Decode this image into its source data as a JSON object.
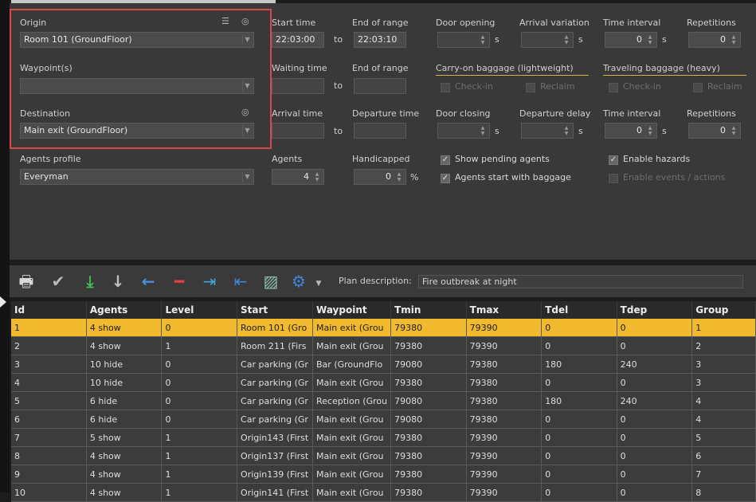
{
  "form": {
    "origin_label": "Origin",
    "origin_value": "Room 101 (GroundFloor)",
    "waypoints_label": "Waypoint(s)",
    "waypoints_value": "",
    "destination_label": "Destination",
    "destination_value": "Main exit (GroundFloor)",
    "agents_profile_label": "Agents profile",
    "agents_profile_value": "Everyman",
    "start_time_label": "Start time",
    "start_time_value": "22:03:00",
    "to": "to",
    "end_range_label": "End of range",
    "end_range_value": "22:03:10",
    "waiting_time_label": "Waiting time",
    "end_range2_label": "End of range",
    "arrival_time_label": "Arrival time",
    "departure_time_label": "Departure time",
    "agents_label": "Agents",
    "agents_value": "4",
    "handicapped_label": "Handicapped",
    "handicapped_value": "0",
    "percent": "%",
    "door_opening_label": "Door opening",
    "arrival_variation_label": "Arrival variation",
    "time_interval_label": "Time interval",
    "time_interval_value": "0",
    "repetitions_label": "Repetitions",
    "repetitions_value": "0",
    "carry_on_label": "Carry-on baggage (lightweight)",
    "traveling_label": "Traveling baggage (heavy)",
    "check_in": "Check-in",
    "reclaim": "Reclaim",
    "door_closing_label": "Door closing",
    "departure_delay_label": "Departure delay",
    "time_interval2_label": "Time interval",
    "time_interval2_value": "0",
    "repetitions2_label": "Repetitions",
    "repetitions2_value": "0",
    "unit_s": "s",
    "show_pending": "Show pending agents",
    "start_with_baggage": "Agents start with baggage",
    "enable_hazards": "Enable hazards",
    "enable_events": "Enable events / actions"
  },
  "toolbar": {
    "plan_description_label": "Plan description:",
    "plan_description_value": "Fire outbreak at night"
  },
  "table": {
    "columns": [
      "Id",
      "Agents",
      "Level",
      "Start",
      "Waypoint",
      "Tmin",
      "Tmax",
      "Tdel",
      "Tdep",
      "Group"
    ],
    "rows": [
      [
        "1",
        "4 show",
        "0",
        "Room 101 (Gro",
        "Main exit (Grou",
        "79380",
        "79390",
        "0",
        "0",
        "1"
      ],
      [
        "2",
        "4 show",
        "1",
        "Room 211 (Firs",
        "Main exit (Grou",
        "79380",
        "79390",
        "0",
        "0",
        "2"
      ],
      [
        "3",
        "10 hide",
        "0",
        "Car parking (Gr",
        "Bar (GroundFlo",
        "79080",
        "79380",
        "180",
        "240",
        "3"
      ],
      [
        "4",
        "10 hide",
        "0",
        "Car parking (Gr",
        "Main exit (Grou",
        "79380",
        "79380",
        "0",
        "0",
        "3"
      ],
      [
        "5",
        "6 hide",
        "0",
        "Car parking (Gr",
        "Reception (Grou",
        "79080",
        "79380",
        "180",
        "240",
        "4"
      ],
      [
        "6",
        "6 hide",
        "0",
        "Car parking (Gr",
        "Main exit (Grou",
        "79080",
        "79380",
        "0",
        "0",
        "4"
      ],
      [
        "7",
        "5 show",
        "1",
        "Origin143 (First",
        "Main exit (Grou",
        "79380",
        "79390",
        "0",
        "0",
        "5"
      ],
      [
        "8",
        "4 show",
        "1",
        "Origin137 (First",
        "Main exit (Grou",
        "79380",
        "79390",
        "0",
        "0",
        "6"
      ],
      [
        "9",
        "4 show",
        "1",
        "Origin139 (First",
        "Main exit (Grou",
        "79380",
        "79390",
        "0",
        "0",
        "7"
      ],
      [
        "10",
        "4 show",
        "1",
        "Origin141 (First",
        "Main exit (Grou",
        "79380",
        "79390",
        "0",
        "0",
        "8"
      ]
    ]
  },
  "colors": {
    "selected_row": "#f0b92e",
    "highlight_border": "#d9464c",
    "accent_underline": "#d9b24a"
  }
}
